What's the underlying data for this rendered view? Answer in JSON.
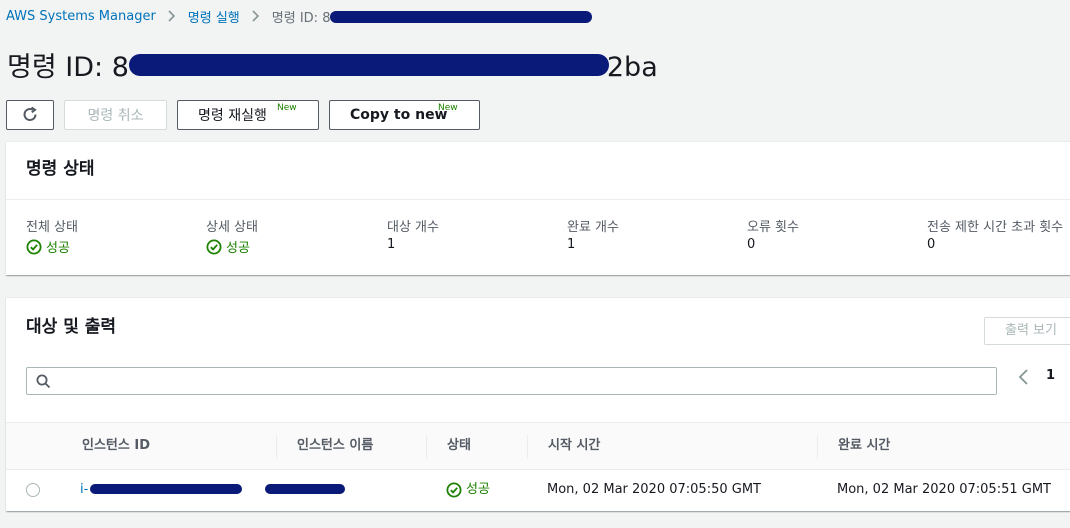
{
  "breadcrumb": {
    "root": "AWS Systems Manager",
    "parent": "명령 실행",
    "current": "명령 ID: 8"
  },
  "title": {
    "prefix": "명령 ID: 8",
    "suffix": "2ba"
  },
  "toolbar": {
    "refresh_icon": "refresh-icon",
    "cancel_label": "명령 취소",
    "rerun_label": "명령 재실행",
    "rerun_badge": "New",
    "copy_label": "Copy to new",
    "copy_badge": "New"
  },
  "status_panel": {
    "heading": "명령 상태",
    "overall_label": "전체 상태",
    "overall_value": "성공",
    "detail_label": "상세 상태",
    "detail_value": "성공",
    "targets_label": "대상 개수",
    "targets_value": "1",
    "completed_label": "완료 개수",
    "completed_value": "1",
    "errors_label": "오류 횟수",
    "errors_value": "0",
    "timeout_label": "전송 제한 시간 초과 횟수",
    "timeout_value": "0"
  },
  "targets_panel": {
    "heading": "대상 및 출력",
    "view_output_label": "출력 보기",
    "search_placeholder": "",
    "page_number": "1",
    "columns": [
      "인스턴스 ID",
      "인스턴스 이름",
      "상태",
      "시작 시간",
      "완료 시간"
    ],
    "rows": [
      {
        "instance_id": "i-",
        "instance_name": "",
        "status": "성공",
        "start_time": "Mon, 02 Mar 2020 07:05:50 GMT",
        "end_time": "Mon, 02 Mar 2020 07:05:51 GMT"
      }
    ]
  },
  "colors": {
    "link": "#0073bb",
    "success": "#1d8102",
    "redaction": "#0a1a78"
  }
}
